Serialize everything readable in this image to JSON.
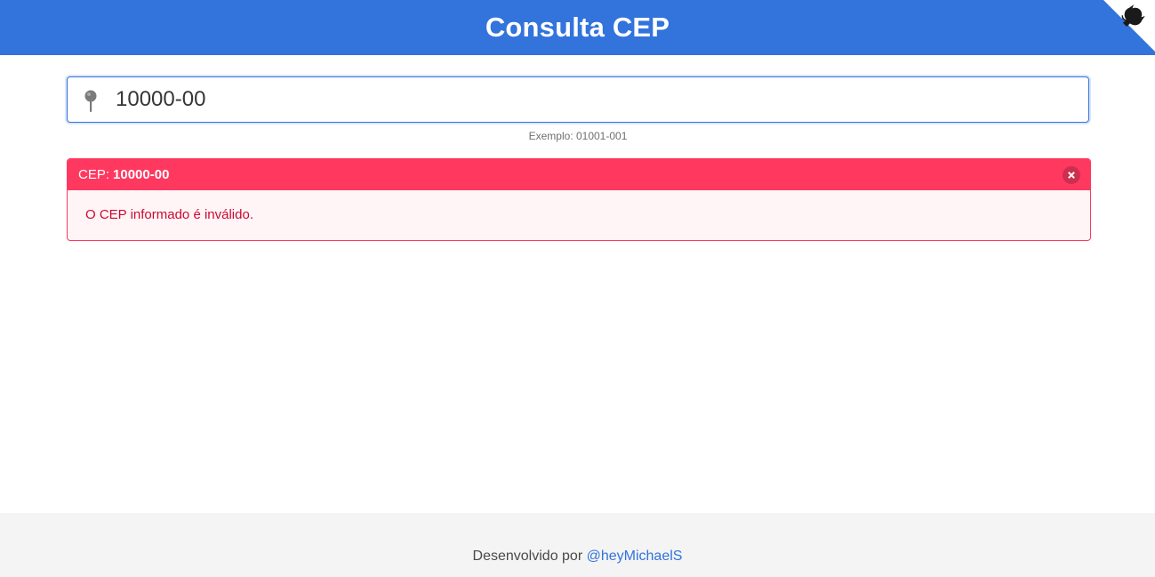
{
  "header": {
    "title": "Consulta CEP",
    "corner_icon": "github-octocat-icon"
  },
  "search": {
    "value": "10000-00",
    "icon": "map-pin-icon",
    "help": "Exemplo: 01001-001"
  },
  "message": {
    "header_label": "CEP:",
    "header_value": "10000-00",
    "body": "O CEP informado é inválido."
  },
  "footer": {
    "text": "Desenvolvido por",
    "link": "@heyMichaelS"
  },
  "colors": {
    "primary": "#3273dc",
    "danger": "#ff3860",
    "danger_text": "#cd0930"
  }
}
